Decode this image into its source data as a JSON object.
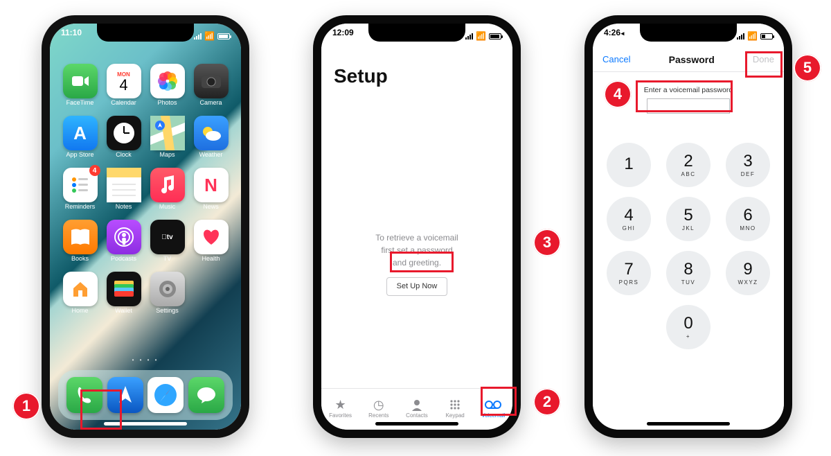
{
  "callouts": {
    "c1": "1",
    "c2": "2",
    "c3": "3",
    "c4": "4",
    "c5": "5"
  },
  "phone1": {
    "time": "11:10",
    "calendar_day": "MON",
    "calendar_date": "4",
    "apps_row1": [
      {
        "label": "FaceTime"
      },
      {
        "label": "Calendar"
      },
      {
        "label": "Photos"
      },
      {
        "label": "Camera"
      }
    ],
    "apps_row2": [
      {
        "label": "App Store"
      },
      {
        "label": "Clock"
      },
      {
        "label": "Maps"
      },
      {
        "label": "Weather"
      }
    ],
    "apps_row3": [
      {
        "label": "Reminders",
        "badge": "4"
      },
      {
        "label": "Notes"
      },
      {
        "label": "Music"
      },
      {
        "label": "News"
      }
    ],
    "apps_row4": [
      {
        "label": "Books"
      },
      {
        "label": "Podcasts"
      },
      {
        "label": "TV"
      },
      {
        "label": "Health"
      }
    ],
    "apps_row5": [
      {
        "label": "Home"
      },
      {
        "label": "Wallet"
      },
      {
        "label": "Settings"
      }
    ],
    "dock": [
      "Phone",
      "Navigate",
      "Safari",
      "Messages"
    ]
  },
  "phone2": {
    "time": "12:09",
    "title": "Setup",
    "body_line1": "To retrieve a voicemail",
    "body_line2": "first set a password",
    "body_line3": "and greeting.",
    "button": "Set Up Now",
    "tabs": [
      {
        "label": "Favorites"
      },
      {
        "label": "Recents"
      },
      {
        "label": "Contacts"
      },
      {
        "label": "Keypad"
      },
      {
        "label": "Voicemail"
      }
    ]
  },
  "phone3": {
    "time": "4:26",
    "nav_left": "Cancel",
    "nav_title": "Password",
    "nav_right": "Done",
    "prompt": "Enter a voicemail password",
    "keypad": [
      {
        "n": "1",
        "l": ""
      },
      {
        "n": "2",
        "l": "ABC"
      },
      {
        "n": "3",
        "l": "DEF"
      },
      {
        "n": "4",
        "l": "GHI"
      },
      {
        "n": "5",
        "l": "JKL"
      },
      {
        "n": "6",
        "l": "MNO"
      },
      {
        "n": "7",
        "l": "PQRS"
      },
      {
        "n": "8",
        "l": "TUV"
      },
      {
        "n": "9",
        "l": "WXYZ"
      },
      {
        "n": "0",
        "l": "+"
      }
    ]
  }
}
